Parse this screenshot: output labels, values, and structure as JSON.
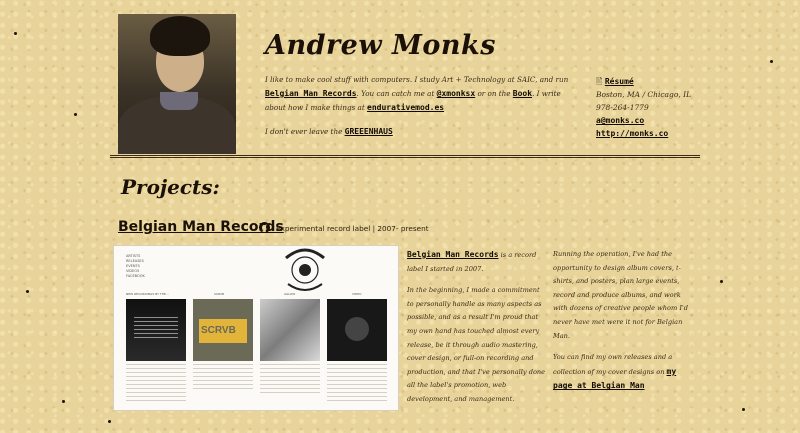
{
  "header": {
    "name": "Andrew Monks",
    "bio": {
      "part1": "I like to make cool stuff with computers. I study Art + Technology at SAIC, and run ",
      "record_link": "Belgian Man Records",
      "part2": ". You can catch me at ",
      "handle_link": "@xmonksx",
      "part3": " or on the ",
      "book_link": "Book",
      "part4": ". I write about how I make things at ",
      "blog_link": "endurativemod.es"
    },
    "leave": {
      "text": "I don't ever leave the ",
      "link": "GREEENHAUS"
    }
  },
  "contact": {
    "resume_label": "Résumé",
    "location": "Boston, MA / Chicago, IL",
    "phone": "978-264-1779",
    "email": "a@monks.co",
    "website": "http://monks.co"
  },
  "projects": {
    "heading": "Projects:",
    "items": [
      {
        "title": "Belgian Man Records",
        "github_icon": "github-icon",
        "description": "Experimental record label | 2007- present",
        "preview": {
          "nav": [
            "ARTISTS",
            "RELEASES",
            "EVENTS",
            "VIDEOS",
            "FACEBOOK"
          ],
          "captions": [
            "NEW RECORDINGS BY THE...",
            "SCRVB",
            "AGLOW",
            "VIDEO"
          ],
          "tile_texts": [
            "SCRVB"
          ]
        },
        "col1": {
          "link": "Belgian Man Records",
          "text1": " is a record label I started in 2007.",
          "text2": "In the beginning, I made a commitment to personally handle as many aspects as possible, and as a result I'm proud that my own hand has touched almost every release, be it through audio mastering, cover design, or full-on recording and production, and that I've personally done all the label's promotion, web development, and management."
        },
        "col2": {
          "text1": "Running the operation, I've had the opportunity to design album covers, t-shirts, and posters, plan large events, record and produce albums, and work with dozens of creative people whom I'd never have met were it not for Belgian Man.",
          "text2": "You can find my own releases and a collection of my cover designs on ",
          "link": "my page at Belgian Man"
        }
      }
    ]
  },
  "colors": {
    "background": "#e8d49a",
    "text": "#2a1d0e",
    "link": "#120b03"
  }
}
